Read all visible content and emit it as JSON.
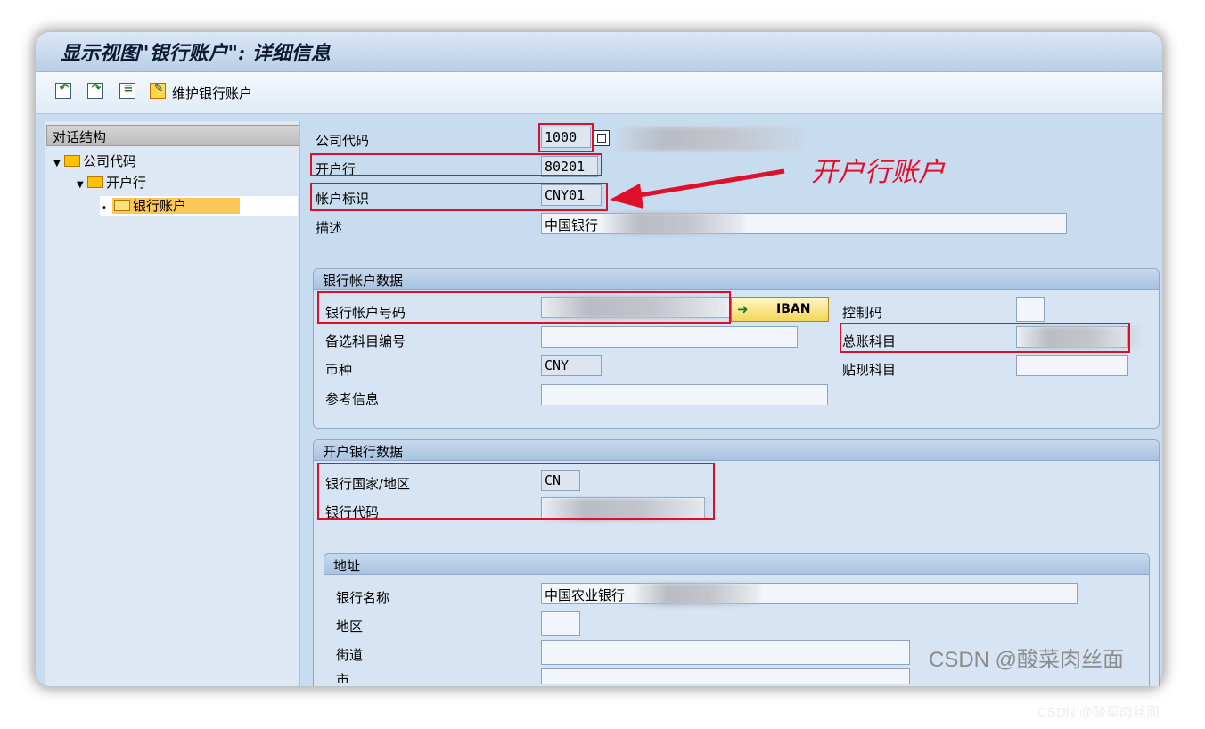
{
  "window": {
    "title": "显示视图\"银行账户\": 详细信息"
  },
  "toolbar": {
    "icons": [
      "back-icon",
      "forward-icon",
      "overview-icon",
      "maintain-icon"
    ],
    "maintain_label": "维护银行账户"
  },
  "nav": {
    "header": "对话结构",
    "items": [
      {
        "label": "公司代码",
        "level": 0,
        "expanded": true
      },
      {
        "label": "开户行",
        "level": 1,
        "expanded": true
      },
      {
        "label": "银行账户",
        "level": 2,
        "selected": true
      }
    ]
  },
  "form": {
    "company_code": {
      "label": "公司代码",
      "value": "1000"
    },
    "house_bank": {
      "label": "开户行",
      "value": "80201"
    },
    "account_id": {
      "label": "帐户标识",
      "value": "CNY01"
    },
    "description": {
      "label": "描述",
      "value": "中国银行"
    }
  },
  "bank_account_data": {
    "header": "银行帐户数据",
    "account_number": {
      "label": "银行帐户号码",
      "value": ""
    },
    "iban_button": "IBAN",
    "control_key": {
      "label": "控制码",
      "value": ""
    },
    "alt_account": {
      "label": "备选科目编号",
      "value": ""
    },
    "gl_account": {
      "label": "总账科目",
      "value": ""
    },
    "currency": {
      "label": "币种",
      "value": "CNY"
    },
    "discount_account": {
      "label": "贴现科目",
      "value": ""
    },
    "reference": {
      "label": "参考信息",
      "value": ""
    }
  },
  "house_bank_data": {
    "header": "开户银行数据",
    "country": {
      "label": "银行国家/地区",
      "value": "CN"
    },
    "bank_key": {
      "label": "银行代码",
      "value": ""
    }
  },
  "address": {
    "header": "地址",
    "bank_name": {
      "label": "银行名称",
      "value": "中国农业银行"
    },
    "region": {
      "label": "地区",
      "value": ""
    },
    "street": {
      "label": "街道",
      "value": ""
    },
    "city": {
      "label": "市",
      "value": ""
    }
  },
  "annotation": "开户行账户",
  "watermark": "CSDN @酸菜肉丝面",
  "colors": {
    "highlight": "#d8102a",
    "selected": "#fbc75a",
    "background": "#c8dcf0"
  }
}
